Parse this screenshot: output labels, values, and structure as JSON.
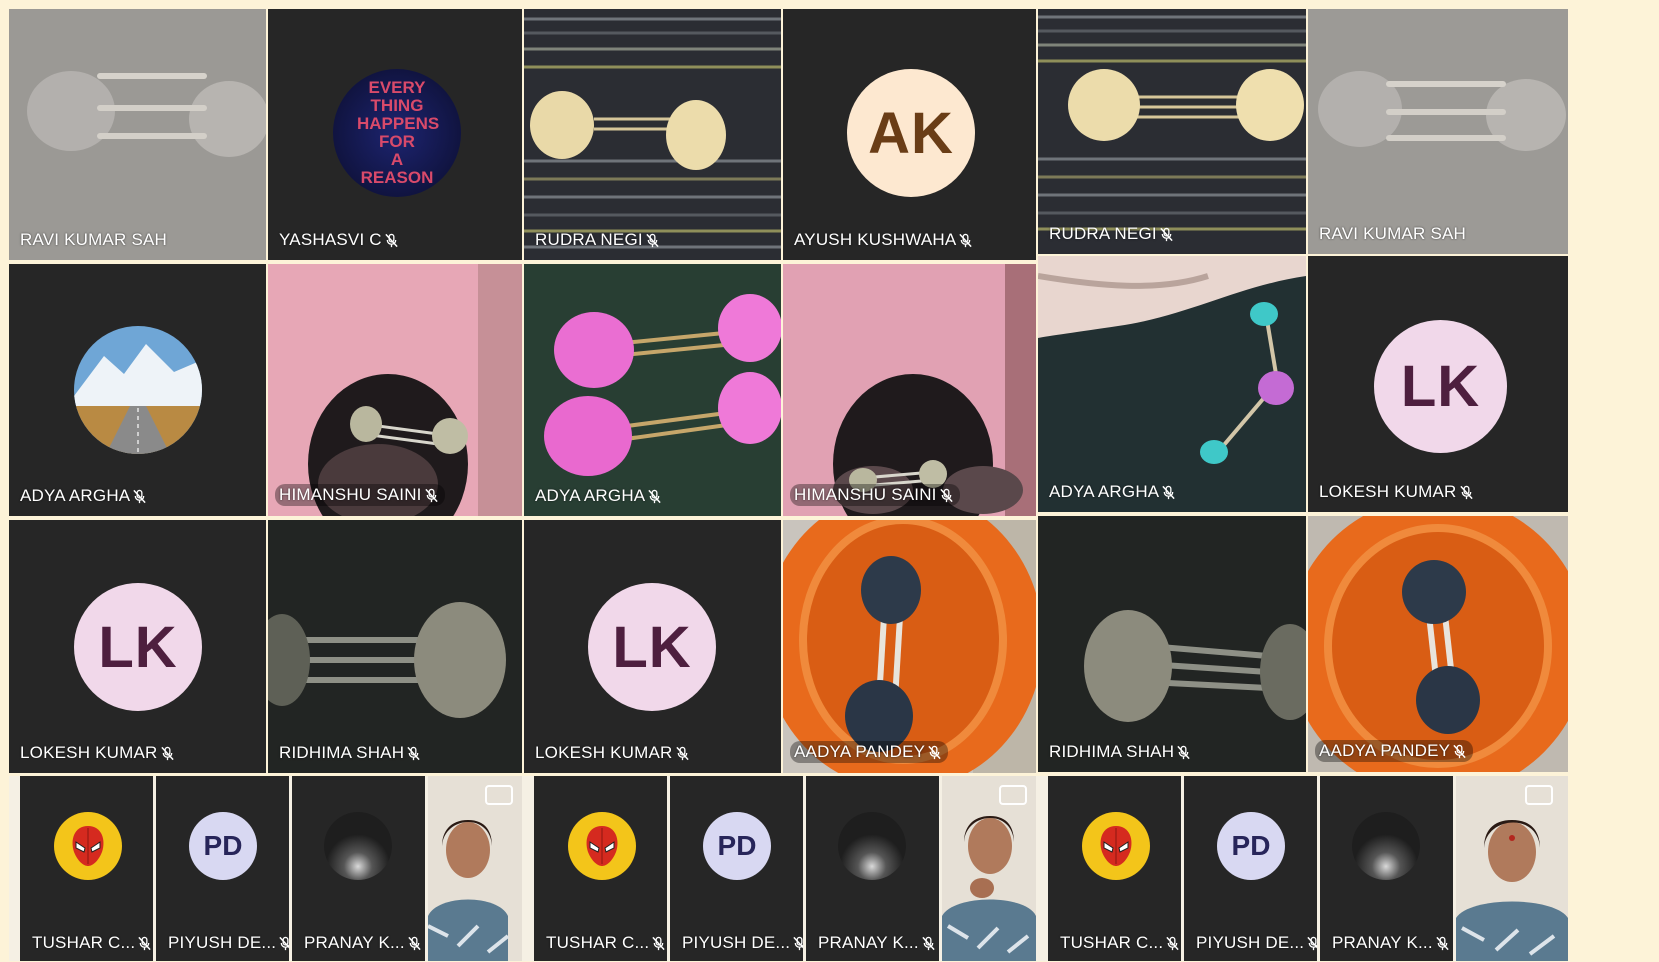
{
  "colors": {
    "tile_bg": "#262626",
    "active_border": "#6f78c8",
    "ak_bg": "#fde8d0",
    "ak_fg": "#6a3d16",
    "lk_bg": "#f1d8ea",
    "lk_fg": "#4e1f3f",
    "pd_bg": "#d8d8f2",
    "pd_fg": "#27255a"
  },
  "grid": {
    "row1": [
      {
        "name": "RAVI KUMAR SAH",
        "muted": false,
        "kind": "video-gray-model"
      },
      {
        "name": "YASHASVI C",
        "muted": true,
        "kind": "avatar-image",
        "avatar_text": "EVERY THING HAPPENS FOR A REASON"
      },
      {
        "name": "RUDRA NEGI",
        "muted": true,
        "kind": "video-striped-model"
      },
      {
        "name": "AYUSH KUSHWAHA",
        "muted": true,
        "kind": "avatar-initials",
        "initials": "AK"
      },
      {
        "name": "RUDRA NEGI",
        "muted": true,
        "kind": "video-striped-model"
      },
      {
        "name": "RAVI KUMAR SAH",
        "muted": false,
        "kind": "video-gray-model"
      }
    ],
    "row2": [
      {
        "name": "ADYA ARGHA",
        "muted": true,
        "kind": "avatar-mountain"
      },
      {
        "name": "HIMANSHU SAINI",
        "muted": true,
        "kind": "video-pink"
      },
      {
        "name": "ADYA ARGHA",
        "muted": true,
        "kind": "video-pink-balls"
      },
      {
        "name": "HIMANSHU SAINI",
        "muted": true,
        "kind": "video-pink"
      },
      {
        "name": "ADYA ARGHA",
        "muted": true,
        "kind": "video-molecule"
      },
      {
        "name": "LOKESH KUMAR",
        "muted": true,
        "kind": "avatar-initials",
        "initials": "LK"
      }
    ],
    "row3": [
      {
        "name": "LOKESH KUMAR",
        "muted": true,
        "kind": "avatar-initials",
        "initials": "LK"
      },
      {
        "name": "RIDHIMA SHAH",
        "muted": true,
        "kind": "video-dark-model"
      },
      {
        "name": "LOKESH KUMAR",
        "muted": true,
        "kind": "avatar-initials",
        "initials": "LK"
      },
      {
        "name": "AADYA PANDEY",
        "muted": true,
        "kind": "video-orange-plate"
      },
      {
        "name": "RIDHIMA SHAH",
        "muted": true,
        "kind": "video-dark-model"
      },
      {
        "name": "AADYA PANDEY",
        "muted": true,
        "kind": "video-orange-plate"
      }
    ]
  },
  "strip": [
    {
      "name": "TUSHAR C...",
      "muted": true,
      "kind": "spider-avatar"
    },
    {
      "name": "PIYUSH DE...",
      "muted": true,
      "kind": "avatar-initials",
      "initials": "PD"
    },
    {
      "name": "PRANAY K...",
      "muted": true,
      "kind": "dark-avatar"
    },
    {
      "name": "",
      "muted": false,
      "kind": "presenter-video"
    }
  ]
}
